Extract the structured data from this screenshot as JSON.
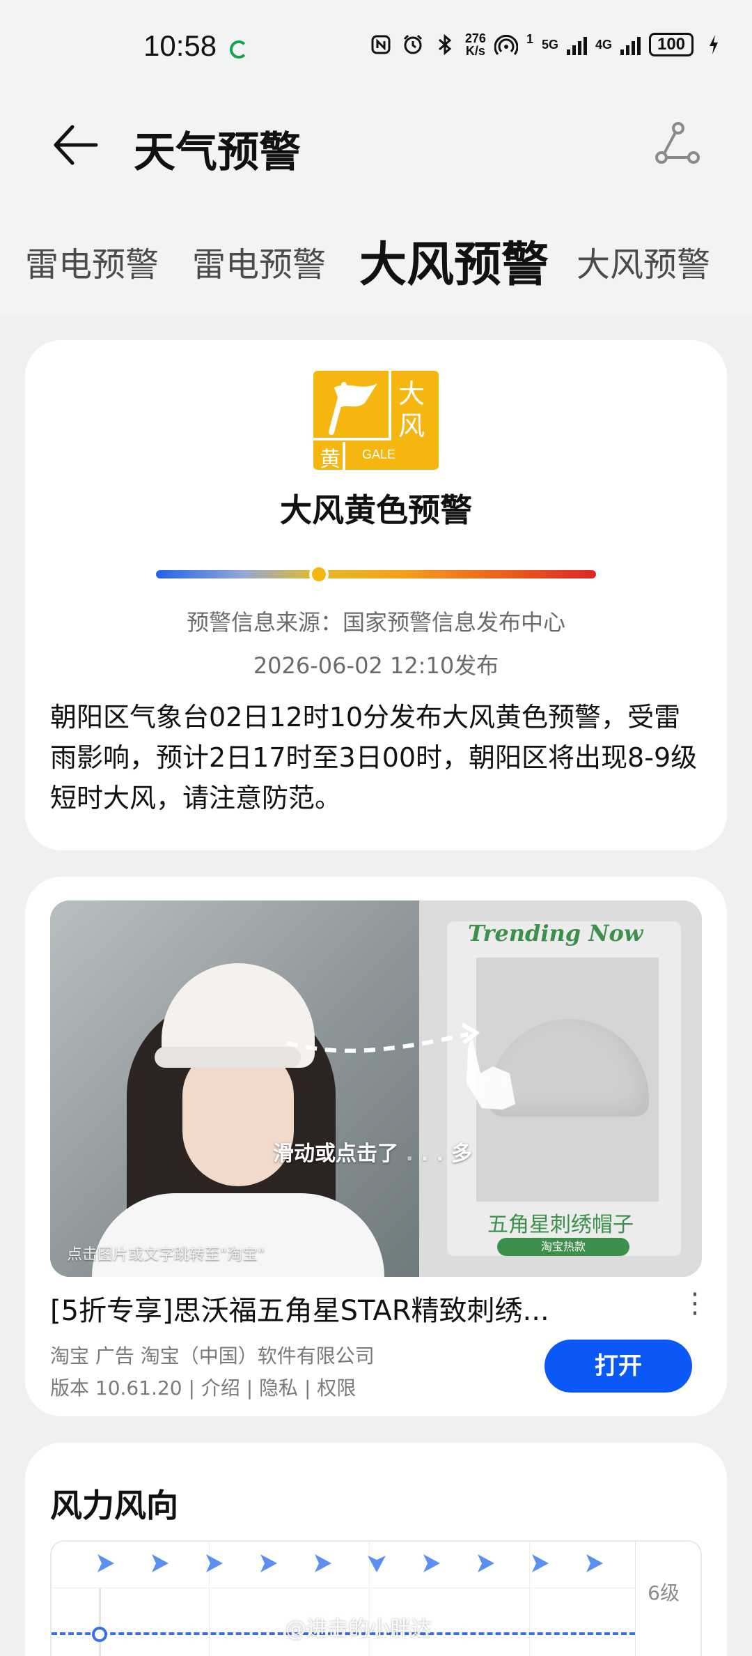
{
  "status_bar": {
    "time": "10:58",
    "net_speed_top": "276",
    "net_speed_bottom": "K/s",
    "sim1": "5G",
    "sim1_slot": "1",
    "sim2": "4G",
    "battery": "100"
  },
  "header": {
    "title": "天气预警"
  },
  "tabs": [
    {
      "label": "雷电预警"
    },
    {
      "label": "雷电预警"
    },
    {
      "label": "大风预警"
    },
    {
      "label": "大风预警"
    }
  ],
  "warning": {
    "icon_char1": "大",
    "icon_char2": "风",
    "icon_color_char": "黄",
    "icon_code": "GALE",
    "title": "大风黄色预警",
    "level_fraction": 0.37,
    "source": "预警信息来源：国家预警信息发布中心",
    "time": "2026-06-02 12:10发布",
    "body": "朝阳区气象台02日12时10分发布大风黄色预警，受雷雨影响，预计2日17时至3日00时，朝阳区将出现8-9级短时大风，请注意防范。",
    "colors": {
      "icon": "#f5b70f",
      "bar_start": "#2563eb",
      "bar_end": "#dc2626"
    }
  },
  "ad": {
    "trending": "Trending Now",
    "product_name": "五角星刺绣帽子",
    "product_tag": "淘宝热款",
    "swipe_hint": "滑动或点击了",
    "swipe_hint_end": "多",
    "tap_hint": "点击图片或文字跳转至\"淘宝\"",
    "title": "[5折专享]思沃福五角星STAR精致刺绣...",
    "more": "⋮",
    "meta_line1": "淘宝  广告  淘宝（中国）软件有限公司",
    "meta_line2": "版本 10.61.20 | 介绍 | 隐私 | 权限",
    "open_label": "打开",
    "colors": {
      "open_button": "#0a59f7",
      "trend_green": "#3d8f4c"
    }
  },
  "wind": {
    "title": "风力风向",
    "level_label": "6级",
    "directions_count": 10,
    "line_color": "#3b6fe0"
  },
  "watermark": "@进击的小胖达"
}
